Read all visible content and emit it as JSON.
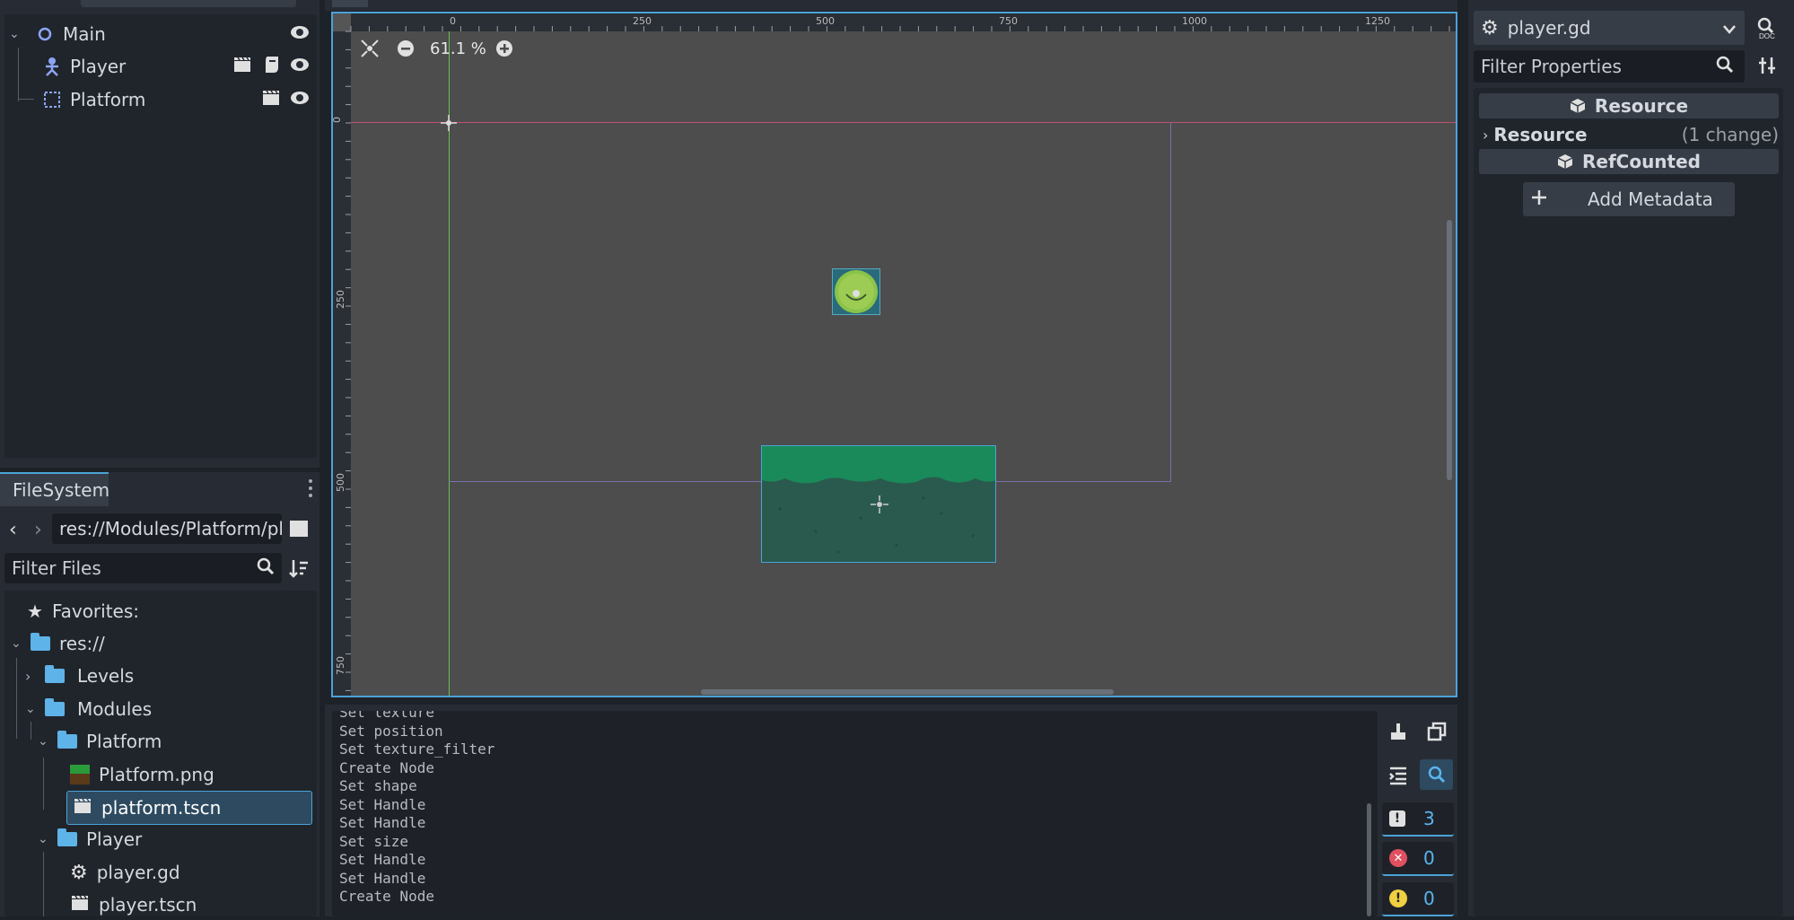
{
  "scene_tree": {
    "nodes": [
      {
        "label": "Main",
        "icon": "node2d-icon"
      },
      {
        "label": "Player",
        "icon": "character-body-icon"
      },
      {
        "label": "Platform",
        "icon": "static-body-icon"
      }
    ]
  },
  "filesystem": {
    "tab_label": "FileSystem",
    "path": "res://Modules/Platform/pla",
    "filter_placeholder": "Filter Files",
    "items": [
      {
        "label": "Favorites:"
      },
      {
        "label": "res://"
      },
      {
        "label": "Levels"
      },
      {
        "label": "Modules"
      },
      {
        "label": "Platform"
      },
      {
        "label": "Platform.png"
      },
      {
        "label": "platform.tscn"
      },
      {
        "label": "Player"
      },
      {
        "label": "player.gd"
      },
      {
        "label": "player.tscn"
      }
    ]
  },
  "viewport": {
    "zoom": "61.1 %",
    "ruler_top": [
      "0",
      "250",
      "500",
      "750",
      "1000",
      "1250"
    ],
    "ruler_left": [
      "0",
      "250",
      "500",
      "750"
    ]
  },
  "output": {
    "lines": [
      "Set texture",
      "Set position",
      "Set texture_filter",
      "Create Node",
      "Set shape",
      "Set Handle",
      "Set Handle",
      "Set size",
      "Set Handle",
      "Set Handle",
      "Create Node"
    ],
    "counts": {
      "messages": "3",
      "errors": "0",
      "warnings": "0"
    }
  },
  "inspector": {
    "resource_name": "player.gd",
    "filter_placeholder": "Filter Properties",
    "section_resource": "Resource",
    "prop_resource_label": "Resource",
    "prop_resource_value": "(1 change)",
    "section_refcounted": "RefCounted",
    "add_metadata": "Add Metadata"
  },
  "colors": {
    "accent": "#4ba3d8",
    "selection": "#2d4a60",
    "platform_top": "#1a8a5a",
    "platform_body": "#2a5a4e",
    "player": "#8bc34a"
  }
}
